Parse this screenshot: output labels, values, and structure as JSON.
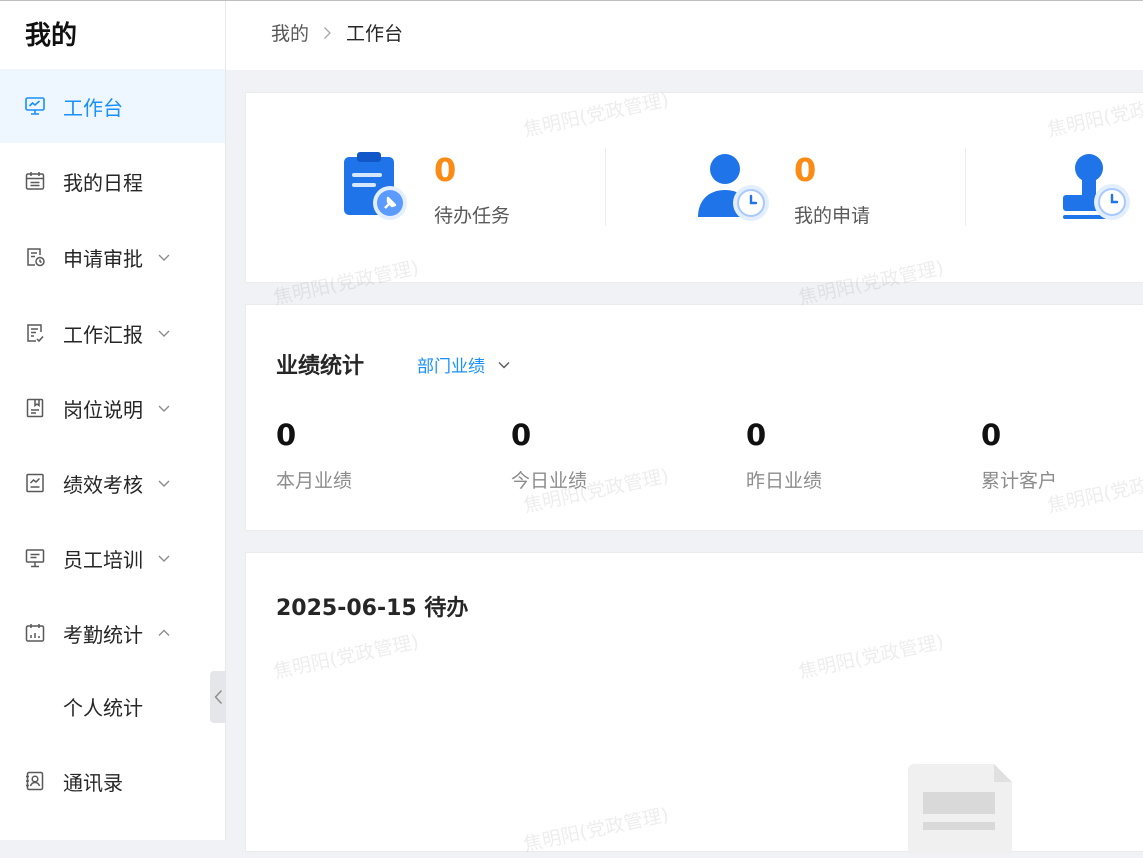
{
  "sidebar": {
    "title": "我的",
    "items": [
      {
        "label": "工作台",
        "icon": "monitor-chart-icon",
        "active": true
      },
      {
        "label": "我的日程",
        "icon": "calendar-icon"
      },
      {
        "label": "申请审批",
        "icon": "document-clock-icon",
        "expandable": true
      },
      {
        "label": "工作汇报",
        "icon": "document-check-icon",
        "expandable": true
      },
      {
        "label": "岗位说明",
        "icon": "document-icon",
        "expandable": true
      },
      {
        "label": "绩效考核",
        "icon": "performance-chart-icon",
        "expandable": true
      },
      {
        "label": "员工培训",
        "icon": "presentation-icon",
        "expandable": true
      },
      {
        "label": "考勤统计",
        "icon": "attendance-calendar-icon",
        "expandable": true,
        "expanded": true
      },
      {
        "label": "个人统计",
        "sub": true
      },
      {
        "label": "通讯录",
        "icon": "contacts-icon"
      }
    ]
  },
  "breadcrumb": {
    "level1": "我的",
    "level2": "工作台"
  },
  "stats": [
    {
      "value": "0",
      "label": "待办任务",
      "icon": "clipboard-pin-icon"
    },
    {
      "value": "0",
      "label": "我的申请",
      "icon": "user-clock-icon"
    },
    {
      "value": "",
      "label": "",
      "icon": "stamp-clock-icon"
    }
  ],
  "performance": {
    "title": "业绩统计",
    "scope_select": "部门业绩",
    "metrics": [
      {
        "value": "0",
        "label": "本月业绩"
      },
      {
        "value": "0",
        "label": "今日业绩"
      },
      {
        "value": "0",
        "label": "昨日业绩"
      },
      {
        "value": "0",
        "label": "累计客户"
      }
    ]
  },
  "todo": {
    "title": "2025-06-15 待办"
  },
  "watermark": "焦明阳(党政管理)",
  "colors": {
    "accent": "#1890ff",
    "highlight": "#fa8c16",
    "active_bg": "#eef6ff"
  }
}
